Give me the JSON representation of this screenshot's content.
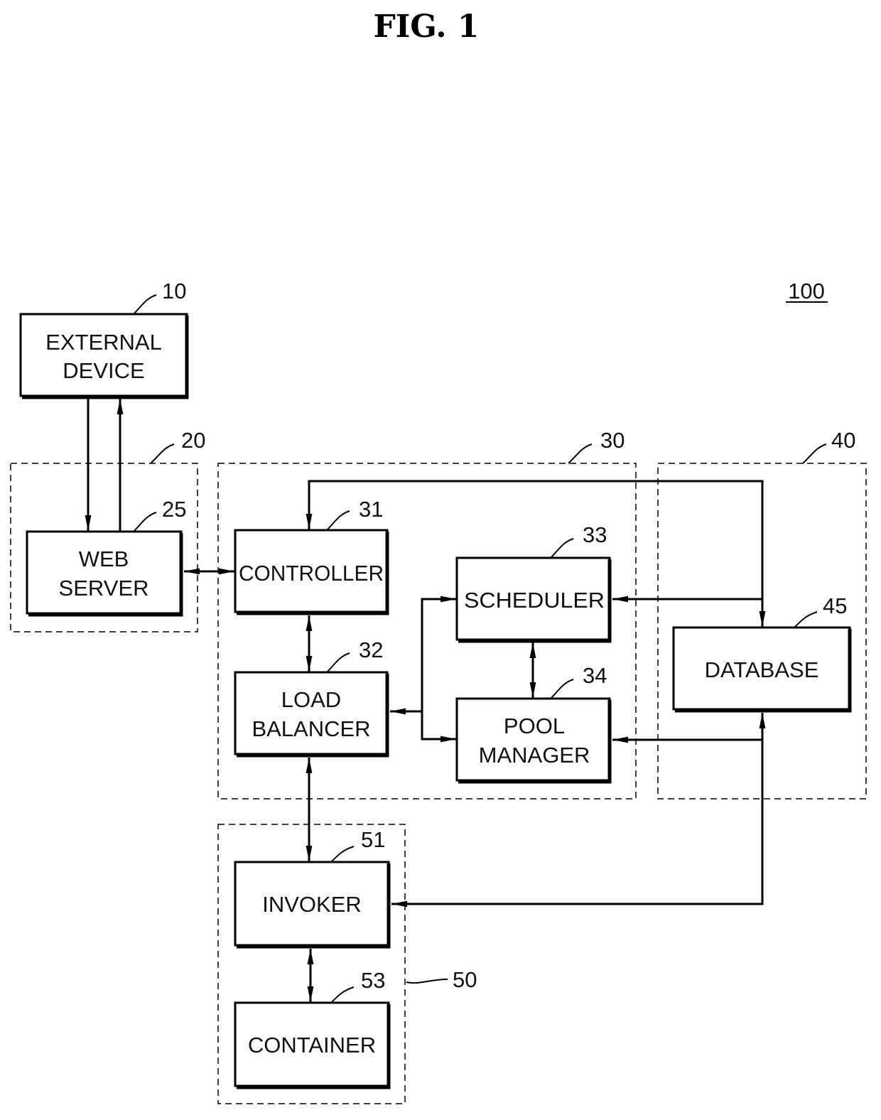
{
  "figure": {
    "title": "FIG.  1",
    "system_ref": "100"
  },
  "groups": [
    {
      "id": "group-20",
      "ref": "20"
    },
    {
      "id": "group-30",
      "ref": "30"
    },
    {
      "id": "group-40",
      "ref": "40"
    },
    {
      "id": "group-50",
      "ref": "50"
    }
  ],
  "blocks": {
    "external_device": {
      "ref": "10",
      "lines": [
        "EXTERNAL",
        "DEVICE"
      ]
    },
    "web_server": {
      "ref": "25",
      "lines": [
        "WEB",
        "SERVER"
      ]
    },
    "controller": {
      "ref": "31",
      "lines": [
        "CONTROLLER"
      ]
    },
    "load_balancer": {
      "ref": "32",
      "lines": [
        "LOAD",
        "BALANCER"
      ]
    },
    "scheduler": {
      "ref": "33",
      "lines": [
        "SCHEDULER"
      ]
    },
    "pool_manager": {
      "ref": "34",
      "lines": [
        "POOL",
        "MANAGER"
      ]
    },
    "database": {
      "ref": "45",
      "lines": [
        "DATABASE"
      ]
    },
    "invoker": {
      "ref": "51",
      "lines": [
        "INVOKER"
      ]
    },
    "container": {
      "ref": "53",
      "lines": [
        "CONTAINER"
      ]
    }
  },
  "connections": [
    {
      "from": "external_device",
      "to": "web_server",
      "direction": "forward"
    },
    {
      "from": "web_server",
      "to": "external_device",
      "direction": "forward"
    },
    {
      "from": "web_server",
      "to": "controller",
      "direction": "bidirectional"
    },
    {
      "from": "database",
      "to": "controller",
      "direction": "forward"
    },
    {
      "from": "controller",
      "to": "load_balancer",
      "direction": "bidirectional"
    },
    {
      "from": "load_balancer",
      "to": "invoker",
      "direction": "bidirectional"
    },
    {
      "from": "junction",
      "to": "load_balancer",
      "direction": "forward"
    },
    {
      "from": "junction",
      "to": "scheduler",
      "direction": "forward"
    },
    {
      "from": "junction",
      "to": "pool_manager",
      "direction": "forward"
    },
    {
      "from": "scheduler",
      "to": "pool_manager",
      "direction": "bidirectional"
    },
    {
      "from": "bus",
      "to": "scheduler",
      "direction": "forward"
    },
    {
      "from": "bus",
      "to": "database",
      "direction": "forward"
    },
    {
      "from": "bus",
      "to": "pool_manager",
      "direction": "forward"
    },
    {
      "from": "bus",
      "to": "database",
      "direction": "forward"
    },
    {
      "from": "database",
      "to": "invoker",
      "direction": "forward"
    },
    {
      "from": "invoker",
      "to": "container",
      "direction": "bidirectional"
    }
  ]
}
